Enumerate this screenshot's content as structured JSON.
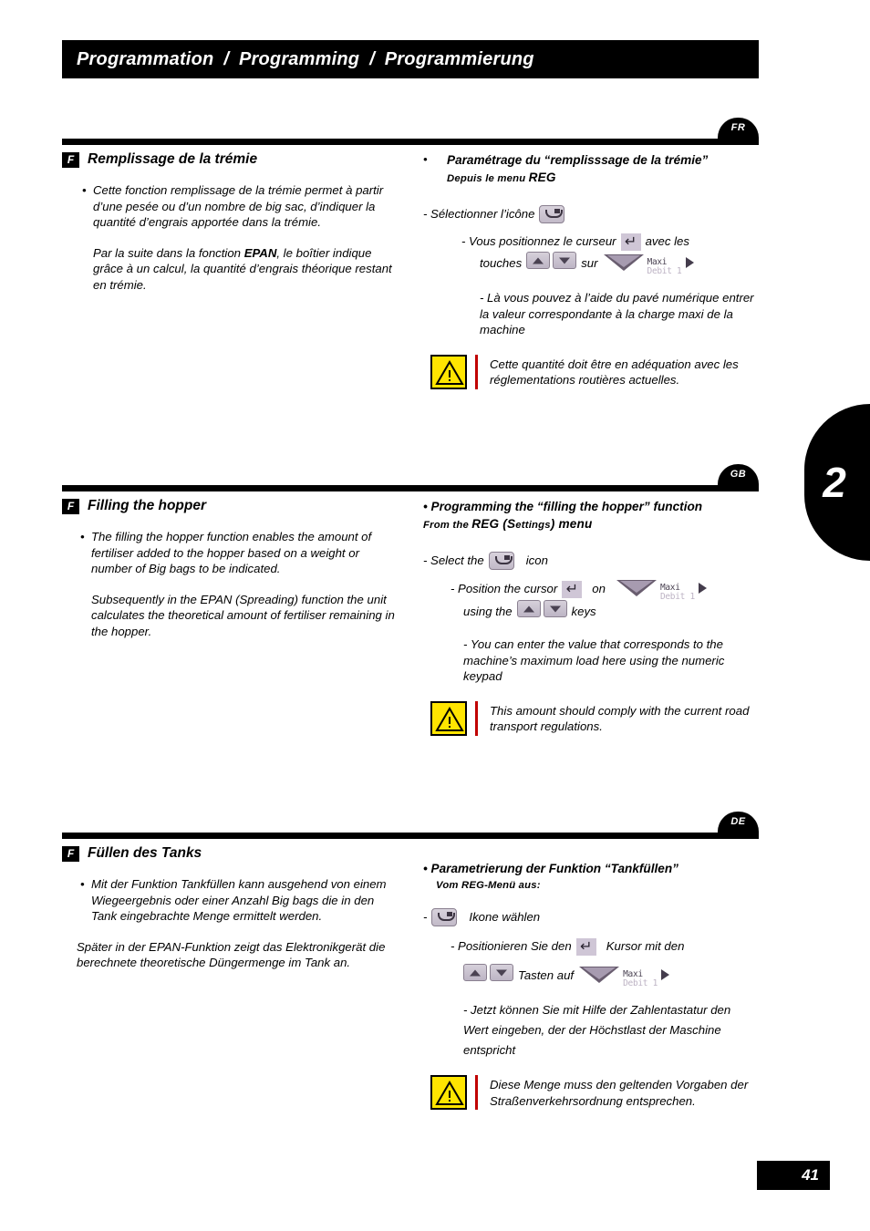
{
  "header": {
    "parts": [
      "Programmation",
      "Programming",
      "Programmierung"
    ],
    "separator": "/"
  },
  "chapter_tab": {
    "number": "2"
  },
  "page_number": "41",
  "icons": {
    "hopper": "hopper-icon",
    "enter": "enter-key-icon",
    "up": "arrow-up-key-icon",
    "down": "arrow-down-key-icon",
    "maxi_label": "Maxi",
    "maxi_label2": "Debit 1",
    "maxi_arrow": "right-triangle-icon"
  },
  "sections": [
    {
      "lang_badge": "FR",
      "flag": "F",
      "title": "Remplissage de la trémie",
      "left": {
        "bullet1": "Cette fonction remplissage de la trémie permet à partir d’une pesée ou d’un nombre de big sac, d’indiquer la quantité d’engrais apportée dans la trémie.",
        "para2_pre": "Par la suite dans la fonction ",
        "para2_bold": "EPAN",
        "para2_post": ", le boîtier indique grâce à un calcul, la quantité d’engrais théorique restant en trémie."
      },
      "right": {
        "subhead": "Paramétrage du “remplisssage de la trémie”",
        "smallcaps_pre": "Depuis le menu ",
        "smallcaps_big": "REG",
        "step1": "- Sélectionner l’icône",
        "step2_a": "- Vous positionnez le curseur",
        "step2_b": "avec les",
        "step2_c": "touches",
        "step2_d": "sur",
        "step3": "- Là vous pouvez à l’aide du pavé numérique entrer la valeur correspondante à la charge maxi de la machine",
        "warning": "Cette quantité doit être en adéquation avec les réglementations routières actuelles."
      }
    },
    {
      "lang_badge": "GB",
      "flag": "F",
      "title": "Filling the hopper",
      "left": {
        "bullet1": "The filling the hopper function enables the amount of fertiliser added to the hopper based on a weight or number of Big bags to be indicated.",
        "para2_pre": "Subsequently in the EPAN (Spreading) function the unit calculates the theoretical amount of fertiliser remaining in the hopper.",
        "para2_bold": "",
        "para2_post": ""
      },
      "right": {
        "subhead": "• Programming the “filling the hopper” function",
        "smallcaps_pre": "From the ",
        "smallcaps_big": "REG (S",
        "smallcaps_mid": "ettings",
        "smallcaps_end": ") menu",
        "step1": "- Select the",
        "step1_after": "icon",
        "step2_a": "- Position the cursor",
        "step2_b": "on",
        "step2_c": "using the",
        "step2_d": "keys",
        "step3": "- You can enter the value that corresponds to the machine’s maximum load here using the numeric keypad",
        "warning": "This amount should comply with the current road transport regulations."
      }
    },
    {
      "lang_badge": "DE",
      "flag": "F",
      "title": "Füllen des Tanks",
      "left": {
        "bullet1": "Mit der Funktion Tankfüllen kann ausgehend von einem Wiegeergebnis oder einer Anzahl Big bags die in den Tank eingebrachte Menge ermittelt werden.",
        "para2_pre": "Später in der EPAN-Funktion zeigt das Elektronikgerät die berechnete theoretische Düngermenge im Tank an.",
        "para2_bold": "",
        "para2_post": ""
      },
      "right": {
        "subhead": "• Parametrierung der Funktion “Tankfüllen”",
        "smallcaps_pre": "Vom REG-Menü aus:",
        "smallcaps_big": "",
        "step1": "-",
        "step1_after": "Ikone wählen",
        "step2_a": "- Positionieren Sie den",
        "step2_b": "Kursor mit den",
        "step2_c": "",
        "step2_d": "Tasten auf",
        "step3": "- Jetzt können Sie mit Hilfe der Zahlentastatur den Wert eingeben, der der Höchstlast der Maschine entspricht",
        "warning": "Diese Menge muss den geltenden Vorgaben der Straßenverkehrsordnung entsprechen."
      }
    }
  ]
}
